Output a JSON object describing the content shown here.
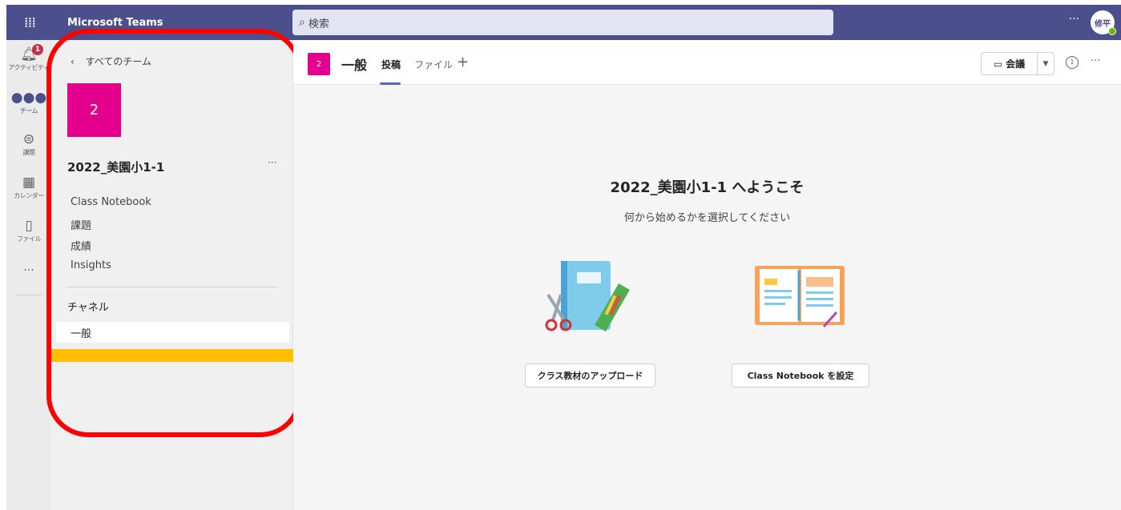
{
  "topbar": {
    "app_title": "Microsoft Teams",
    "search_placeholder": "検索",
    "more": "···",
    "avatar_initials": "修平"
  },
  "rail": {
    "items": [
      {
        "label": "アクティビティ",
        "icon": "bell-icon",
        "badge": "1"
      },
      {
        "label": "チーム",
        "icon": "teams-icon"
      },
      {
        "label": "課題",
        "icon": "backpack-icon"
      },
      {
        "label": "カレンダー",
        "icon": "calendar-icon"
      },
      {
        "label": "ファイル",
        "icon": "file-icon"
      }
    ],
    "more": "···"
  },
  "team_panel": {
    "back_label": "すべてのチーム",
    "tile_number": "2",
    "team_name": "2022_美園小1-1",
    "more": "···",
    "links": [
      "Class Notebook",
      "課題",
      "成績",
      "Insights"
    ],
    "channels_header": "チャネル",
    "channels": [
      "一般"
    ]
  },
  "header": {
    "tile_number": "2",
    "channel_name": "一般",
    "tabs": [
      "投稿",
      "ファイル"
    ],
    "add_tab": "+",
    "meet_label": "会議",
    "more": "···"
  },
  "welcome": {
    "title": "2022_美園小1-1 へようこそ",
    "subtitle": "何から始めるかを選択してください",
    "upload_button": "クラス教材のアップロード",
    "notebook_button": "Class Notebook を設定"
  },
  "colors": {
    "topbar": "#4b4f8c",
    "team_tile": "#e3008c",
    "annotation_red": "#ff0000",
    "annotation_yellow": "#ffbf00",
    "accent": "#5b5fc7"
  }
}
